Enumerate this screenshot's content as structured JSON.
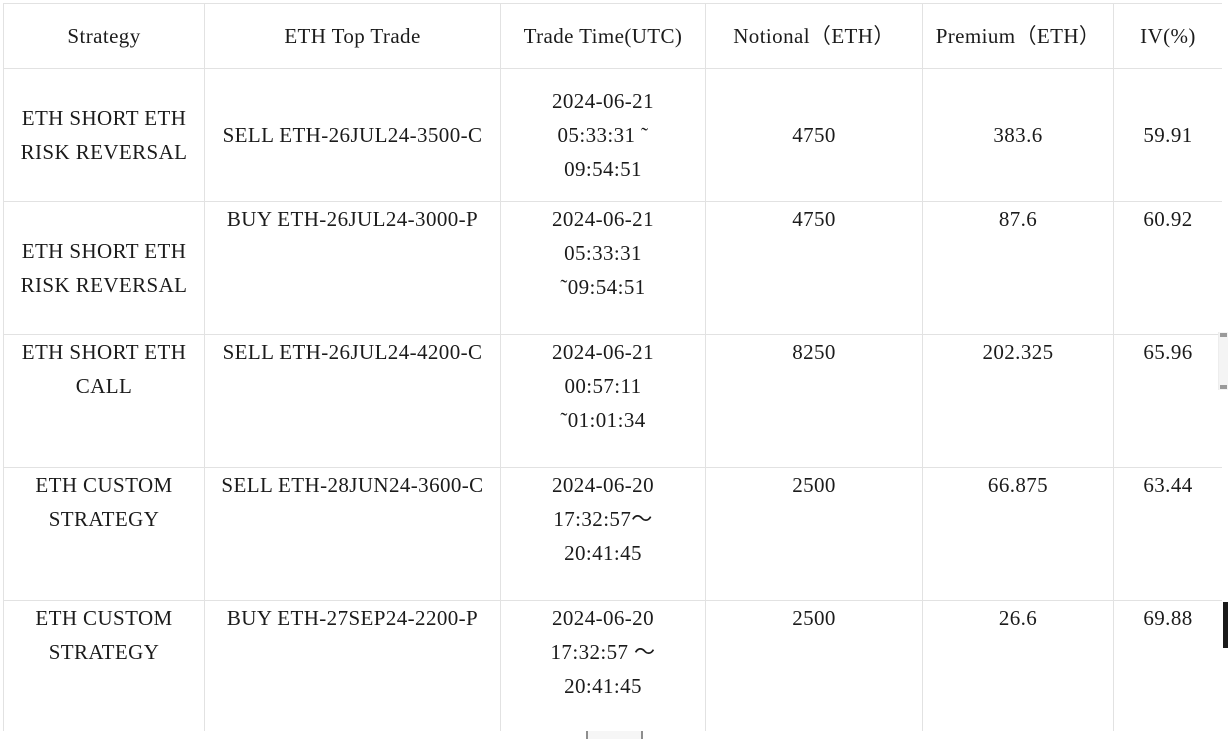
{
  "table": {
    "name": "eth-top-trades",
    "columns": [
      {
        "key": "strategy",
        "label": "Strategy"
      },
      {
        "key": "trade",
        "label": "ETH Top Trade"
      },
      {
        "key": "time",
        "label": "Trade Time(UTC)"
      },
      {
        "key": "notional",
        "label": "Notional（ETH）"
      },
      {
        "key": "premium",
        "label": "Premium（ETH）"
      },
      {
        "key": "iv",
        "label": "IV(%)"
      }
    ],
    "rows": [
      {
        "strategy": "ETH SHORT ETH RISK REVERSAL",
        "trade": "SELL ETH-26JUL24-3500-C",
        "time": "2024-06-21\n05:33:31 ˜\n09:54:51",
        "notional": "4750",
        "premium": "383.6",
        "iv": "59.91",
        "align": {
          "strategy": "mid",
          "trade": "mid",
          "time": "mid",
          "notional": "mid",
          "premium": "mid",
          "iv": "mid"
        }
      },
      {
        "strategy": "ETH SHORT ETH RISK REVERSAL",
        "trade": "BUY ETH-26JUL24-3000-P",
        "time": "2024-06-21\n05:33:31\n˜09:54:51",
        "notional": "4750",
        "premium": "87.6",
        "iv": "60.92",
        "align": {
          "strategy": "mid",
          "trade": "top",
          "time": "top",
          "notional": "top",
          "premium": "top",
          "iv": "top"
        }
      },
      {
        "strategy": "ETH SHORT ETH CALL",
        "trade": "SELL ETH-26JUL24-4200-C",
        "time": "2024-06-21\n00:57:11\n˜01:01:34",
        "notional": "8250",
        "premium": "202.325",
        "iv": "65.96",
        "align": {
          "strategy": "top",
          "trade": "top",
          "time": "top",
          "notional": "top",
          "premium": "top",
          "iv": "top"
        }
      },
      {
        "strategy": "ETH CUSTOM STRATEGY",
        "trade": "SELL ETH-28JUN24-3600-C",
        "time": "2024-06-20\n17:32:57〜\n20:41:45",
        "notional": "2500",
        "premium": "66.875",
        "iv": "63.44",
        "align": {
          "strategy": "top",
          "trade": "top",
          "time": "top",
          "notional": "top",
          "premium": "top",
          "iv": "top"
        }
      },
      {
        "strategy": "ETH CUSTOM STRATEGY",
        "trade": "BUY ETH-27SEP24-2200-P",
        "time": "2024-06-20\n17:32:57 〜\n20:41:45",
        "notional": "2500",
        "premium": "26.6",
        "iv": "69.88",
        "align": {
          "strategy": "top",
          "trade": "top",
          "time": "top",
          "notional": "top",
          "premium": "top",
          "iv": "top"
        }
      }
    ]
  },
  "scrollbars": {
    "vertical_present": true,
    "horizontal_present": true
  },
  "colors": {
    "border": "#e2e2e2",
    "text": "#1b1b1b",
    "background": "#ffffff",
    "scroll_thumb": "#1a1a1a"
  }
}
